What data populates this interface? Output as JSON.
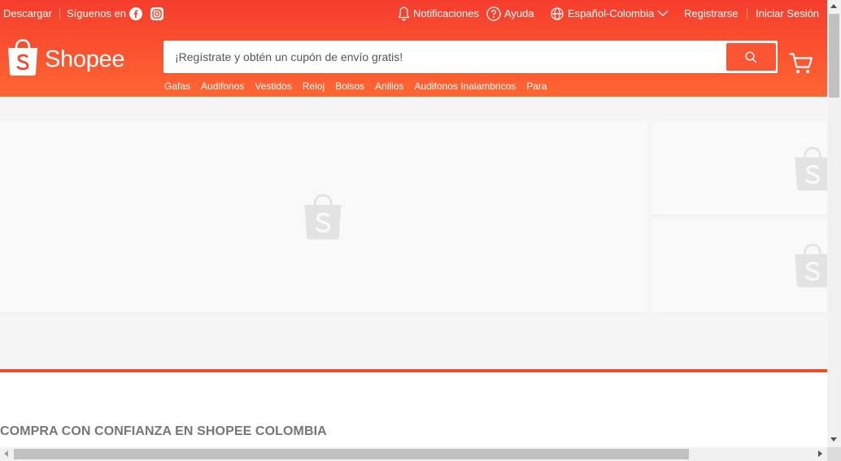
{
  "topbar": {
    "download": "Descargar",
    "follow_us": "Síguenos en",
    "notifications": "Notificaciones",
    "help": "Ayuda",
    "language": "Español-Colombia",
    "register": "Registrarse",
    "login": "Iniciar Sesión"
  },
  "brand": {
    "name": "Shopee",
    "color": "#ee4d2d"
  },
  "search": {
    "placeholder": "¡Regístrate y obtén un cupón de envío gratis!"
  },
  "suggestions": [
    "Gafas",
    "Audifonos",
    "Vestidos",
    "Reloj",
    "Bolsos",
    "Anillos",
    "Audifonos Inalambricos",
    "Para"
  ],
  "icons": {
    "facebook": "facebook-icon",
    "instagram": "instagram-icon",
    "bell": "bell-icon",
    "help": "help-circle-icon",
    "globe": "globe-icon",
    "chevron": "chevron-down-icon",
    "search": "search-icon",
    "cart": "cart-icon"
  },
  "sections": {
    "trust_title": "COMPRA CON CONFIANZA EN SHOPEE COLOMBIA"
  }
}
